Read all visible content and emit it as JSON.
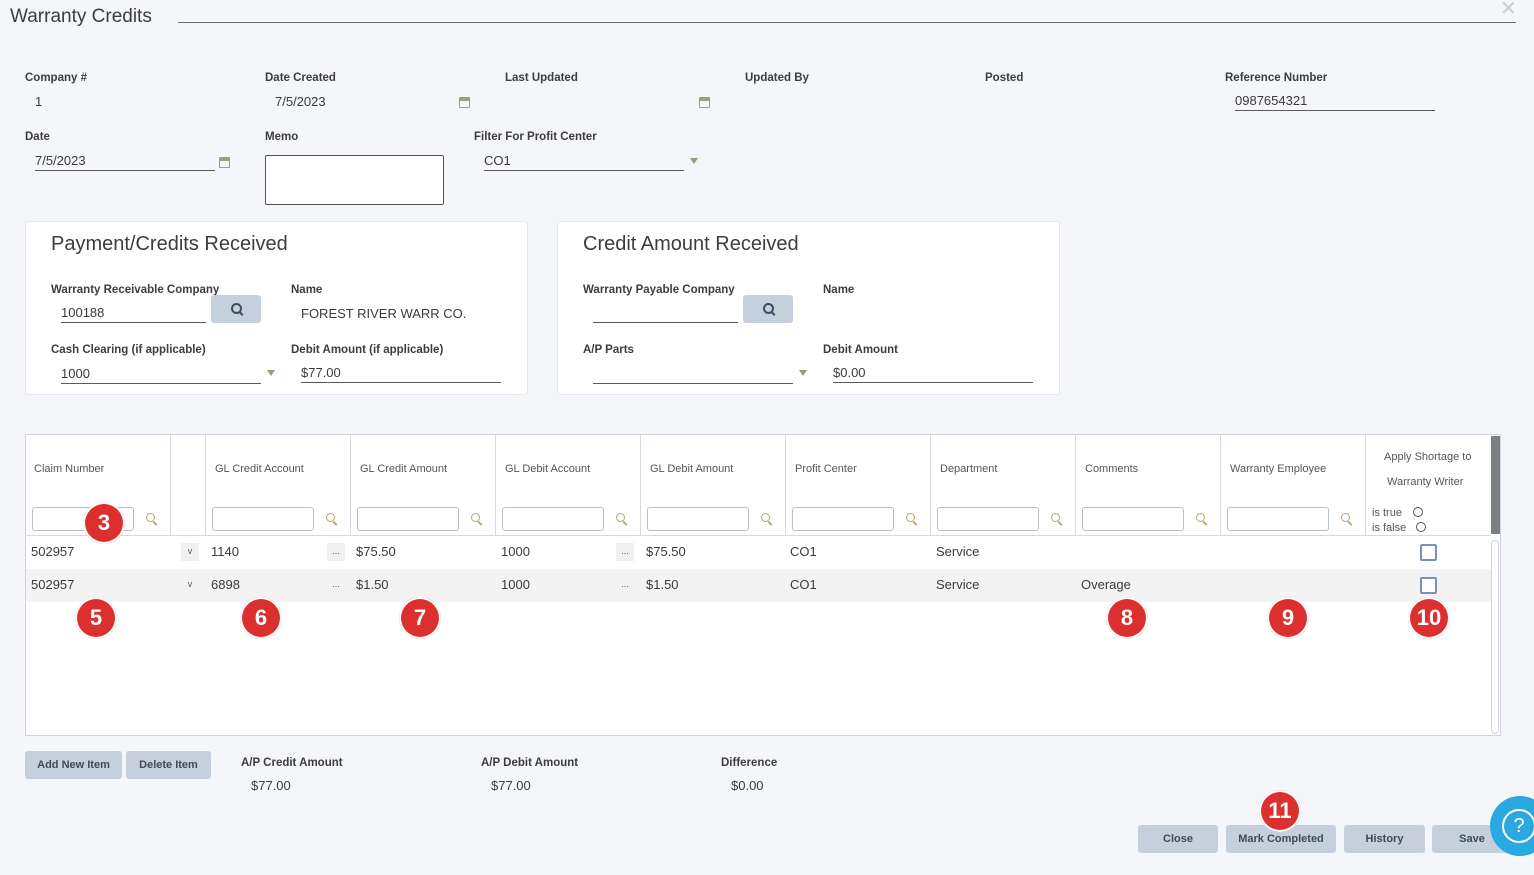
{
  "window": {
    "title": "Warranty Credits"
  },
  "header": {
    "company_label": "Company #",
    "company_value": "1",
    "date_created_label": "Date Created",
    "date_created_value": "7/5/2023",
    "last_updated_label": "Last Updated",
    "updated_by_label": "Updated By",
    "posted_label": "Posted",
    "reference_label": "Reference Number",
    "reference_value": "0987654321",
    "date_label": "Date",
    "date_value": "7/5/2023",
    "memo_label": "Memo",
    "memo_value": "",
    "filter_label": "Filter For Profit Center",
    "filter_value": "CO1"
  },
  "payment_panel": {
    "title": "Payment/Credits Received",
    "receivable_label": "Warranty Receivable Company",
    "receivable_value": "100188",
    "name_label": "Name",
    "name_value": "FOREST RIVER WARR CO.",
    "cash_label": "Cash Clearing (if applicable)",
    "cash_value": "1000",
    "debit_label": "Debit Amount (if applicable)",
    "debit_value": "$77.00"
  },
  "credit_panel": {
    "title": "Credit Amount Received",
    "payable_label": "Warranty Payable Company",
    "payable_value": "",
    "name_label": "Name",
    "name_value": "",
    "ap_parts_label": "A/P Parts",
    "ap_parts_value": "",
    "debit_label": "Debit Amount",
    "debit_value": "$0.00"
  },
  "grid": {
    "columns": [
      "Claim Number",
      "",
      "GL Credit Account",
      "GL Credit Amount",
      "GL Debit Account",
      "GL Debit Amount",
      "Profit Center",
      "Department",
      "Comments",
      "Warranty Employee"
    ],
    "apply_col": {
      "line1": "Apply Shortage to",
      "line2": "Warranty Writer",
      "is_true": "is true",
      "is_false": "is false"
    },
    "rows": [
      {
        "claim": "502957",
        "v": "v",
        "credit_acct": "1140",
        "credit_amt": "$75.50",
        "debit_acct": "1000",
        "debit_amt": "$75.50",
        "profit_center": "CO1",
        "department": "Service",
        "comments": "",
        "employee": "",
        "ellipsis": "..."
      },
      {
        "claim": "502957",
        "v": "v",
        "credit_acct": "6898",
        "credit_amt": "$1.50",
        "debit_acct": "1000",
        "debit_amt": "$1.50",
        "profit_center": "CO1",
        "department": "Service",
        "comments": "Overage",
        "employee": "",
        "ellipsis": "..."
      }
    ]
  },
  "footer": {
    "add_item": "Add New Item",
    "delete_item": "Delete Item",
    "ap_credit_label": "A/P Credit Amount",
    "ap_credit_value": "$77.00",
    "ap_debit_label": "A/P Debit Amount",
    "ap_debit_value": "$77.00",
    "difference_label": "Difference",
    "difference_value": "$0.00"
  },
  "actions": {
    "close": "Close",
    "mark_completed": "Mark Completed",
    "history": "History",
    "save": "Save"
  },
  "badges": [
    "3",
    "5",
    "6",
    "7",
    "8",
    "9",
    "10",
    "11"
  ],
  "help": {
    "glyph": "?"
  },
  "colors": {
    "badge": "#dc2f2f",
    "button": "#c6d0dc",
    "help": "#2aa9e0"
  }
}
